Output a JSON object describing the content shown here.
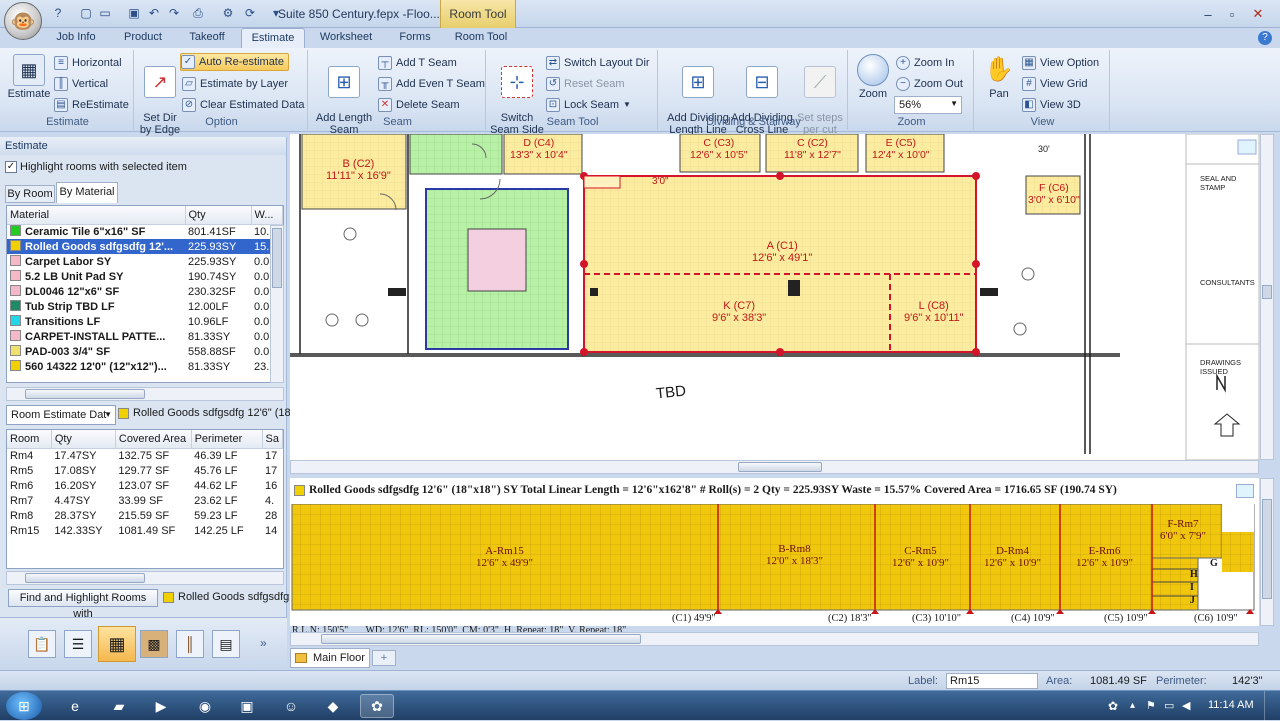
{
  "window": {
    "doc_title": "Suite 850 Century.fepx -Floo...",
    "context_tab": "Room Tool",
    "minimize_icon": "minimize-icon",
    "maximize_icon": "maximize-icon",
    "close_icon": "close-icon"
  },
  "tabs": [
    "Job Info",
    "Product",
    "Takeoff",
    "Estimate",
    "Worksheet",
    "Forms",
    "Room Tool"
  ],
  "ribbon": {
    "estimate_group": {
      "label": "Estimate",
      "estimate": "Estimate",
      "horizontal": "Horizontal",
      "vertical": "Vertical",
      "reestimate": "ReEstimate"
    },
    "option_group": {
      "label": "Option",
      "set_dir": "Set Dir\nby Edge",
      "auto_reestimate": "Auto Re-estimate",
      "estimate_by_layer": "Estimate by Layer",
      "clear_estimated": "Clear Estimated Data"
    },
    "seam_group": {
      "label": "Seam",
      "add_length_seam": "Add Length\nSeam",
      "add_t_seam": "Add T Seam",
      "add_even_t_seam": "Add Even T Seam",
      "delete_seam": "Delete Seam"
    },
    "seamtool_group": {
      "label": "Seam Tool",
      "switch_seam_side": "Switch\nSeam Side",
      "switch_layout_dir": "Switch Layout Dir",
      "reset_seam": "Reset Seam",
      "lock_seam": "Lock Seam"
    },
    "dividing_group": {
      "label": "Dividing & Stairway",
      "add_dividing_length": "Add Dividing\nLength Line",
      "add_dividing_cross": "Add Dividing\nCross Line",
      "set_steps": "Set steps\nper cut"
    },
    "zoom_group": {
      "label": "Zoom",
      "zoom": "Zoom",
      "zoom_in": "Zoom In",
      "zoom_out": "Zoom Out",
      "zoom_level": "56%"
    },
    "view_group": {
      "label": "View",
      "pan": "Pan",
      "view_option": "View Option",
      "view_grid": "View Grid",
      "view_3d": "View 3D"
    }
  },
  "left_panel": {
    "title": "Estimate",
    "highlight_checkbox": "Highlight rooms with selected item",
    "subtabs": [
      "By Room",
      "By Material"
    ],
    "material_headers": [
      "Material",
      "Qty",
      "W..."
    ],
    "materials": [
      {
        "name": "Ceramic Tile  6\"x16\" SF",
        "qty": "801.41SF",
        "w": "10.",
        "color": "#22cc22"
      },
      {
        "name": "Rolled Goods sdfgsdfg 12'...",
        "qty": "225.93SY",
        "w": "15.",
        "color": "#f0d000"
      },
      {
        "name": "Carpet Labor  SY",
        "qty": "225.93SY",
        "w": "0.0",
        "color": "#f5b8c8"
      },
      {
        "name": "5.2 LB Unit Pad  SY",
        "qty": "190.74SY",
        "w": "0.0",
        "color": "#f5b8c8"
      },
      {
        "name": "DL0046  12\"x6\" SF",
        "qty": "230.32SF",
        "w": "0.0",
        "color": "#f5b8c8"
      },
      {
        "name": "Tub Strip TBD LF",
        "qty": "12.00LF",
        "w": "0.0",
        "color": "#1f8a6a"
      },
      {
        "name": "Transitions  LF",
        "qty": "10.96LF",
        "w": "0.0",
        "color": "#22d8e8"
      },
      {
        "name": "CARPET-INSTALL PATTE...",
        "qty": "81.33SY",
        "w": "0.0",
        "color": "#f5b8c8"
      },
      {
        "name": "PAD-003 3/4\"  SF",
        "qty": "558.88SF",
        "w": "0.0",
        "color": "#f0e070"
      },
      {
        "name": "560 14322 12'0\" (12\"x12\")...",
        "qty": "81.33SY",
        "w": "23.",
        "color": "#f0d000"
      }
    ],
    "room_estimate_dropdown": "Room Estimate Dat",
    "room_estimate_item": "Rolled Goods sdfgsdfg 12'6\" (18\"",
    "room_headers": [
      "Room",
      "Qty",
      "Covered Area",
      "Perimeter",
      "Sa"
    ],
    "rooms": [
      {
        "room": "Rm4",
        "qty": "17.47SY",
        "area": "132.75 SF",
        "perim": "46.39 LF",
        "sa": "17"
      },
      {
        "room": "Rm5",
        "qty": "17.08SY",
        "area": "129.77 SF",
        "perim": "45.76 LF",
        "sa": "17"
      },
      {
        "room": "Rm6",
        "qty": "16.20SY",
        "area": "123.07 SF",
        "perim": "44.62 LF",
        "sa": "16"
      },
      {
        "room": "Rm7",
        "qty": "4.47SY",
        "area": "33.99 SF",
        "perim": "23.62 LF",
        "sa": "4."
      },
      {
        "room": "Rm8",
        "qty": "28.37SY",
        "area": "215.59 SF",
        "perim": "59.23 LF",
        "sa": "28"
      },
      {
        "room": "Rm15",
        "qty": "142.33SY",
        "area": "1081.49 SF",
        "perim": "142.25 LF",
        "sa": "14"
      }
    ],
    "find_button": "Find and Highlight Rooms with",
    "find_item": "Rolled Goods sdfgsdfg"
  },
  "drawing": {
    "rooms": [
      {
        "name": "B (C2)",
        "size": "11'11\" x 16'9\""
      },
      {
        "name": "D (C4)",
        "size": "13'3\" x 10'4\""
      },
      {
        "name": "C (C3)",
        "size": "12'6\" x 10'5\""
      },
      {
        "name": "C (C2)",
        "size": "11'8\" x 12'7\""
      },
      {
        "name": "E (C5)",
        "size": "12'4\" x 10'0\""
      },
      {
        "name": "F (C6)",
        "size": "3'0\" x 6'10\""
      },
      {
        "name": "A (C1)",
        "size": "12'6\" x 49'1\""
      },
      {
        "name": "K (C7)",
        "size": "9'6\" x 38'3\""
      },
      {
        "name": "L (C8)",
        "size": "9'6\" x 10'11\""
      }
    ],
    "dim_3ft": "3'0\"",
    "dim_30": "30'",
    "tbd": "TBD",
    "north": "N",
    "seal": "SEAL AND STAMP",
    "consultants": "CONSULTANTS",
    "drawings_issued": "DRAWINGS ISSUED"
  },
  "roll": {
    "summary": "Rolled Goods sdfgsdfg 12'6\" (18\"x18\") SY Total Linear Length = 12'6\"x162'8\" # Roll(s) = 2 Qty = 225.93SY Waste = 15.57% Covered Area = 1716.65 SF (190.74 SY)",
    "pieces": [
      {
        "name": "A-Rm15",
        "size": "12'6\" x 49'9\""
      },
      {
        "name": "B-Rm8",
        "size": "12'0\" x 18'3\""
      },
      {
        "name": "C-Rm5",
        "size": "12'6\" x 10'9\""
      },
      {
        "name": "D-Rm4",
        "size": "12'6\" x 10'9\""
      },
      {
        "name": "E-Rm6",
        "size": "12'6\" x 10'9\""
      },
      {
        "name": "F-Rm7",
        "size": "6'0\" x 7'9\""
      }
    ],
    "letters": [
      "G",
      "H",
      "I",
      "J"
    ],
    "cut_labels": [
      "(C1) 49'9\"",
      "(C2) 18'3\"",
      "(C3) 10'10\"",
      "(C4) 10'9\"",
      "(C5) 10'9\"",
      "(C6) 10'9\""
    ],
    "footer": "R.L.N: 150'5\"       WD: 12'6\"  RL: 150'0\"  CM: 0'3\"  H. Repeat: 18\"  V. Repeat: 18\""
  },
  "sheet_tab": "Main Floor",
  "status": {
    "label_caption": "Label:",
    "label_value": "Rm15",
    "area_caption": "Area:",
    "area_value": "1081.49 SF",
    "perimeter_caption": "Perimeter:",
    "perimeter_value": "142'3\""
  },
  "taskbar": {
    "time": "11:14 AM"
  }
}
